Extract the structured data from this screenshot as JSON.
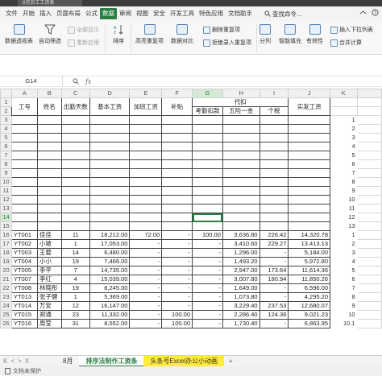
{
  "titlebar": {
    "tab_label": "8月员工工资表"
  },
  "menubar": {
    "items": [
      "文件",
      "开始",
      "插入",
      "页面布局",
      "公式",
      "数据",
      "审阅",
      "视图",
      "安全",
      "开发工具",
      "特色应用",
      "文档助手"
    ],
    "active_index": 5,
    "search_text": "查找命令..."
  },
  "ribbon": {
    "pivot": "数据透视表",
    "autofilter": "自动筛选",
    "show_all": "全部显示",
    "reapply": "重新应用",
    "sort": "排序",
    "highlight_dup": "高亮重复项",
    "data_compare": "数据对比",
    "remove_dup": "删除重复项",
    "reject_dup": "拒绝录入重复项",
    "split": "分列",
    "smart_fill": "智能填充",
    "valid": "有效性",
    "dropdown_list": "插入下拉列表",
    "merge_calc": "合并计算"
  },
  "formula_bar": {
    "name_box": "G14",
    "formula": ""
  },
  "columns": [
    "A",
    "B",
    "C",
    "D",
    "E",
    "F",
    "G",
    "H",
    "I",
    "J",
    "K"
  ],
  "header": {
    "id": "工号",
    "name": "姓名",
    "days": "出勤天数",
    "base": "基本工资",
    "overtime": "加班工资",
    "subsidy": "补贴",
    "deduct_group": "代扣",
    "attendance": "考勤扣款",
    "insurance": "五险一金",
    "tax": "个税",
    "net": "实发工资"
  },
  "blank_rows": [
    {
      "rn": "3",
      "k": "1"
    },
    {
      "rn": "4",
      "k": "2"
    },
    {
      "rn": "5",
      "k": "3"
    },
    {
      "rn": "6",
      "k": "4"
    },
    {
      "rn": "7",
      "k": "5"
    },
    {
      "rn": "8",
      "k": "6"
    },
    {
      "rn": "9",
      "k": "7"
    },
    {
      "rn": "10",
      "k": "8"
    },
    {
      "rn": "11",
      "k": "9"
    },
    {
      "rn": "12",
      "k": "10"
    },
    {
      "rn": "13",
      "k": "11"
    },
    {
      "rn": "14",
      "k": "12"
    },
    {
      "rn": "15",
      "k": "13"
    }
  ],
  "rows": [
    {
      "rn": "16",
      "id": "YT001",
      "name": "佳佳",
      "days": "11",
      "base": "18,212.00",
      "ot": "72.00",
      "sub": "-",
      "att": "100.00",
      "ins": "3,636.80",
      "tax": "226.42",
      "net": "14,320.78",
      "k": "1"
    },
    {
      "rn": "17",
      "id": "YT002",
      "name": "小坡",
      "days": "1",
      "base": "17,053.00",
      "ot": "-",
      "sub": "-",
      "att": "-",
      "ins": "3,410.60",
      "tax": "229.27",
      "net": "13,413.13",
      "k": "2"
    },
    {
      "rn": "18",
      "id": "YT003",
      "name": "王婺",
      "days": "14",
      "base": "6,480.00",
      "ot": "-",
      "sub": "-",
      "att": "-",
      "ins": "1,296.00",
      "tax": "-",
      "net": "5,184.00",
      "k": "3"
    },
    {
      "rn": "19",
      "id": "YT004",
      "name": "小小",
      "days": "19",
      "base": "7,466.00",
      "ot": "-",
      "sub": "-",
      "att": "-",
      "ins": "1,493.20",
      "tax": "-",
      "net": "5,972.80",
      "k": "4"
    },
    {
      "rn": "20",
      "id": "YT005",
      "name": "李平",
      "days": "7",
      "base": "14,735.00",
      "ot": "-",
      "sub": "-",
      "att": "-",
      "ins": "2,947.00",
      "tax": "173.64",
      "net": "11,614.36",
      "k": "5"
    },
    {
      "rn": "21",
      "id": "YT007",
      "name": "李红",
      "days": "4",
      "base": "15,039.00",
      "ot": "-",
      "sub": "-",
      "att": "-",
      "ins": "3,007.80",
      "tax": "180.94",
      "net": "11,850.26",
      "k": "6"
    },
    {
      "rn": "22",
      "id": "YT008",
      "name": "林晓彤",
      "days": "19",
      "base": "8,245.00",
      "ot": "-",
      "sub": "-",
      "att": "-",
      "ins": "1,649.00",
      "tax": "-",
      "net": "6,596.00",
      "k": "7"
    },
    {
      "rn": "23",
      "id": "YT013",
      "name": "张子健",
      "days": "1",
      "base": "5,369.00",
      "ot": "-",
      "sub": "-",
      "att": "-",
      "ins": "1,073.80",
      "tax": "-",
      "net": "4,295.20",
      "k": "8"
    },
    {
      "rn": "24",
      "id": "YT014",
      "name": "万安",
      "days": "12",
      "base": "16,147.00",
      "ot": "-",
      "sub": "-",
      "att": "-",
      "ins": "3,229.40",
      "tax": "237.53",
      "net": "12,680.07",
      "k": "9"
    },
    {
      "rn": "25",
      "id": "YT015",
      "name": "郑通",
      "days": "23",
      "base": "11,332.00",
      "ot": "-",
      "sub": "100.00",
      "att": "-",
      "ins": "2,286.40",
      "tax": "124.36",
      "net": "9,021.23",
      "k": "10"
    },
    {
      "rn": "26",
      "id": "YT016",
      "name": "周莹",
      "days": "31",
      "base": "8,552.00",
      "ot": "-",
      "sub": "100.00",
      "att": "-",
      "ins": "1,730.40",
      "tax": "-",
      "net": "6,863.95",
      "k": "10.1"
    }
  ],
  "tabs": {
    "nav": [
      "K",
      "<",
      ">",
      "X"
    ],
    "sheet1": "8月",
    "sheet2": "排序法制作工资条",
    "sheet3": "头条号Excel办公小动画",
    "add": "+"
  },
  "status": {
    "protect": "文档未保护"
  }
}
